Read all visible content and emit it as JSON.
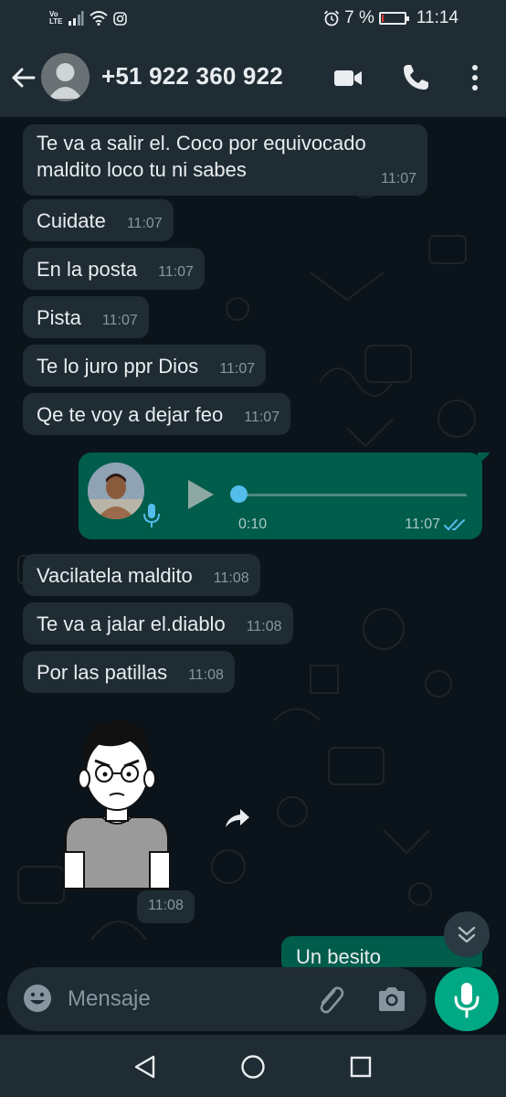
{
  "status_bar": {
    "network": "Vo LTE",
    "battery_percent": "7 %",
    "battery_level": 0.07,
    "time": "11:14",
    "icons": [
      "signal-icon",
      "wifi-icon",
      "instagram-icon",
      "alarm-icon",
      "battery-icon"
    ]
  },
  "header": {
    "contact": "+51 922 360 922",
    "icons": [
      "back-arrow-icon",
      "avatar-icon",
      "video-call-icon",
      "phone-icon",
      "more-vert-icon"
    ]
  },
  "messages": [
    {
      "text": "Te va a salir el. Coco por equivocado\nmaldito loco tu ni sabes",
      "time": "11:07"
    },
    {
      "text": "Cuidate",
      "time": "11:07"
    },
    {
      "text": "En la posta",
      "time": "11:07"
    },
    {
      "text": "Pista",
      "time": "11:07"
    },
    {
      "text": "Te lo juro ppr Dios",
      "time": "11:07"
    },
    {
      "text": "Qe te voy a dejar feo",
      "time": "11:07"
    },
    {
      "text": "Vacilatela maldito",
      "time": "11:08"
    },
    {
      "text": "Te va a jalar el.diablo",
      "time": "11:08"
    },
    {
      "text": "Por las patillas",
      "time": "11:08"
    }
  ],
  "voice_message": {
    "duration": "0:10",
    "time": "11:07",
    "progress": 0.0,
    "status": "read",
    "icons": [
      "mic-icon",
      "play-icon",
      "double-check-icon"
    ]
  },
  "sticker": {
    "time": "11:08",
    "icons": [
      "forward-icon"
    ]
  },
  "partial_message": {
    "text": "Un besito"
  },
  "input": {
    "placeholder": "Mensaje",
    "value": "",
    "icons": [
      "emoji-icon",
      "attach-icon",
      "camera-icon",
      "mic-icon"
    ]
  },
  "nav": {
    "icons": [
      "back-triangle-icon",
      "home-circle-icon",
      "recents-square-icon"
    ]
  },
  "colors": {
    "background": "#0b141a",
    "bar": "#1f2c34",
    "incoming_bubble": "#1f2c34",
    "outgoing_bubble": "#005c4b",
    "accent": "#00a884",
    "read_ticks": "#53bdeb",
    "muted_text": "#8696a0"
  }
}
